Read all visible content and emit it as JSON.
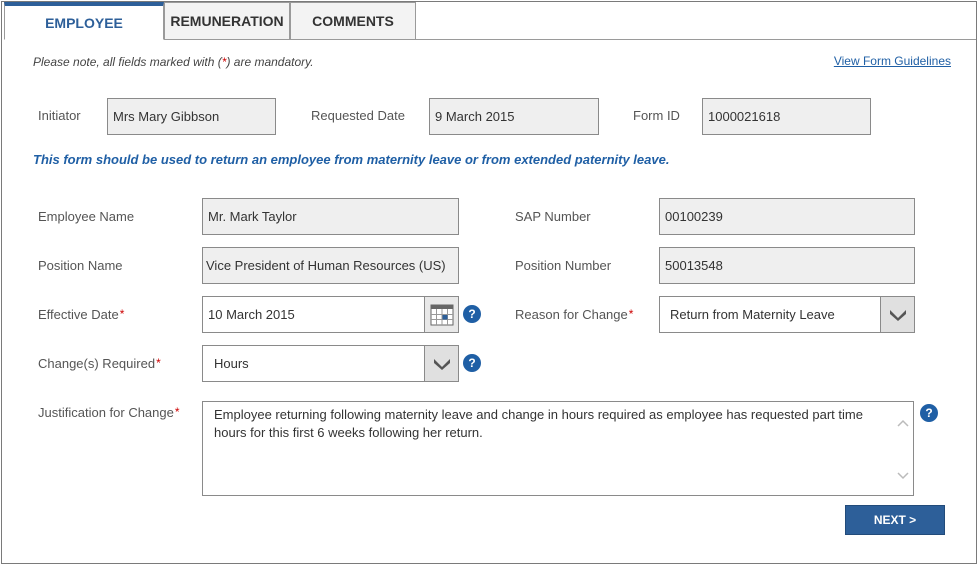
{
  "tabs": [
    {
      "label": "EMPLOYEE",
      "active": true
    },
    {
      "label": "REMUNERATION",
      "active": false
    },
    {
      "label": "COMMENTS",
      "active": false
    }
  ],
  "note": {
    "prefix": "Please note, all fields marked with (",
    "star": "*",
    "suffix": ") are mandatory."
  },
  "guidelines_link": "View Form Guidelines",
  "header": {
    "initiator_label": "Initiator",
    "initiator_value": "Mrs Mary Gibbson",
    "requested_date_label": "Requested Date",
    "requested_date_value": "9 March 2015",
    "form_id_label": "Form ID",
    "form_id_value": "1000021618"
  },
  "info_text": "This form should be used to return an employee from maternity leave or from extended paternity leave.",
  "fields": {
    "employee_name_label": "Employee Name",
    "employee_name_value": "Mr. Mark Taylor",
    "sap_number_label": "SAP Number",
    "sap_number_value": "00100239",
    "position_name_label": "Position Name",
    "position_name_value": "Vice President of Human Resources (US)",
    "position_number_label": "Position Number",
    "position_number_value": "50013548",
    "effective_date_label": "Effective Date",
    "effective_date_value": "10 March 2015",
    "reason_label": "Reason for Change",
    "reason_value": "Return from Maternity Leave",
    "changes_label": "Change(s) Required",
    "changes_value": "Hours",
    "justification_label": "Justification for Change",
    "justification_value": "Employee returning following maternity leave and change in hours required as employee has requested part time hours for this first 6 weeks following her return."
  },
  "required_mark": "*",
  "help_glyph": "?",
  "next_label": "NEXT >",
  "colors": {
    "accent": "#2d5f99",
    "link": "#1f5fa5",
    "required": "#cc0000"
  },
  "icons": [
    "calendar-icon",
    "chevron-down-icon",
    "help-icon",
    "scroll-up-icon",
    "scroll-down-icon"
  ]
}
